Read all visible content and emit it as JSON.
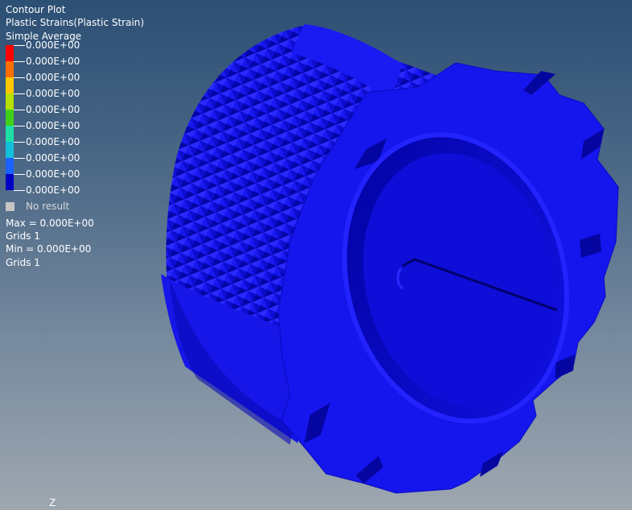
{
  "legend": {
    "title": "Contour Plot",
    "result_type": "Plastic Strains(Plastic Strain)",
    "averaging": "Simple Average",
    "scale_values": [
      "0.000E+00",
      "0.000E+00",
      "0.000E+00",
      "0.000E+00",
      "0.000E+00",
      "0.000E+00",
      "0.000E+00",
      "0.000E+00",
      "0.000E+00",
      "0.000E+00"
    ],
    "scale_colors": [
      "#ff0000",
      "#ff6f00",
      "#ffc800",
      "#b5e000",
      "#3fd11a",
      "#1ee0a6",
      "#13bfd9",
      "#1a62ff",
      "#0000c4"
    ],
    "no_result_label": "No result",
    "no_result_color": "#c6c6c6",
    "max_label": "Max = 0.000E+00",
    "max_grid": "Grids 1",
    "min_label": "Min = 0.000E+00",
    "min_grid": "Grids 1"
  },
  "axis": {
    "label": "Z"
  },
  "model": {
    "fill_color": "#1414ee",
    "shade_color": "#0a0ab0",
    "dark_color": "#03037a"
  }
}
